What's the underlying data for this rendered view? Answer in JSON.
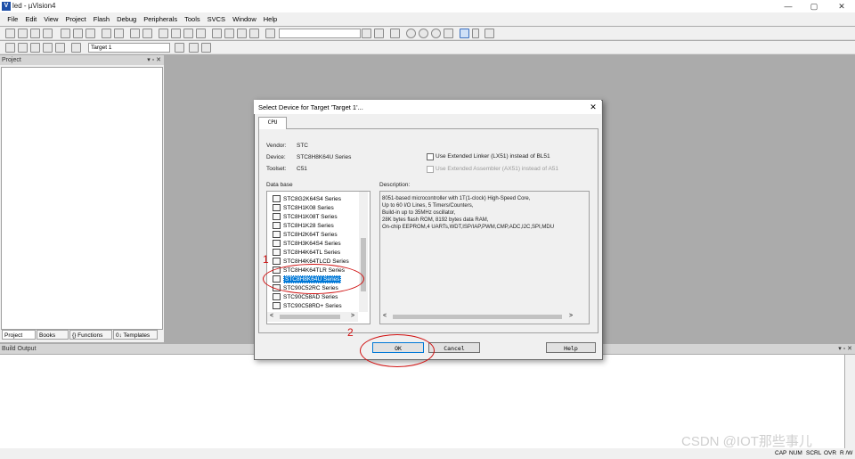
{
  "window": {
    "title": "led - µVision4",
    "logo_glyph": "V"
  },
  "window_controls": {
    "minimize": "—",
    "maximize": "▢",
    "close": "✕"
  },
  "menu": [
    "File",
    "Edit",
    "View",
    "Project",
    "Flash",
    "Debug",
    "Peripherals",
    "Tools",
    "SVCS",
    "Window",
    "Help"
  ],
  "toolbar2": {
    "target": "Target 1"
  },
  "project_panel": {
    "title": "Project",
    "controls": "▾ ▫ ✕",
    "tabs": [
      "Project",
      "Books",
      "{} Functions",
      "0↓ Templates"
    ]
  },
  "build_output": {
    "title": "Build Output",
    "controls": "▾ ▫ ✕"
  },
  "status": {
    "items": [
      "CAP",
      "NUM",
      "SCRL",
      "OVR",
      "R /W"
    ]
  },
  "dialog": {
    "title": "Select Device for Target 'Target 1'...",
    "close": "✕",
    "tab": "CPU",
    "vendor_label": "Vendor:",
    "vendor": "STC",
    "device_label": "Device:",
    "device": "STC8H8K64U Series",
    "toolset_label": "Toolset:",
    "toolset": "C51",
    "opt_linker": "Use Extended Linker (LX51) instead of BL51",
    "opt_assembler": "Use Extended Assembler (AX51) instead of A51",
    "database_label": "Data base",
    "description_label": "Description:",
    "database_items": [
      "STC8G2K64S4 Series",
      "STC8H1K08 Series",
      "STC8H1K08T Series",
      "STC8H1K28 Series",
      "STC8H2K64T Series",
      "STC8H3K64S4 Series",
      "STC8H4K64TL Series",
      "STC8H4K64TLCD Series",
      "STC8H4K64TLR Series",
      "STC8H8K64U Series",
      "STC90C52RC Series",
      "STC90C58AD Series",
      "STC90C58RD+ Series"
    ],
    "selected_index": 9,
    "description_lines": [
      "8051-based microcontroller with 1T(1-clock) High-Speed Core,",
      "Up to 60 I/O Lines, 5 Timers/Counters,",
      "Build-in up to 35MHz oscillator,",
      "28K bytes flash ROM, 8192 bytes data RAM,",
      "On-chip EEPROM,4 UARTs,WDT,ISP/IAP,PWM,CMP,ADC,I2C,SPI,MDU"
    ],
    "buttons": {
      "ok": "OK",
      "cancel": "Cancel",
      "help": "Help"
    },
    "scroll_left": "<",
    "scroll_right": ">"
  },
  "annotations": {
    "one": "1",
    "two": "2"
  },
  "watermark": "CSDN @IOT那些事儿",
  "colors": {
    "selection": "#0078d7",
    "annotation": "#d01010",
    "workspace": "#ababab"
  }
}
